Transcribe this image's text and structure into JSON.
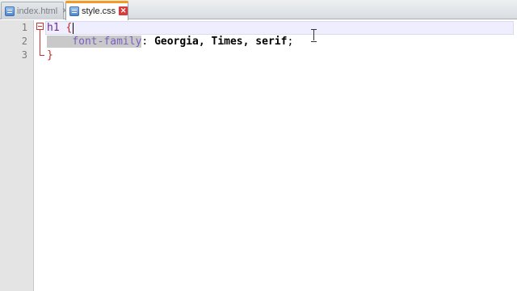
{
  "tabs": [
    {
      "label": "index.html",
      "active": false,
      "icon": "html-file-icon"
    },
    {
      "label": "style.css",
      "active": true,
      "icon": "css-file-icon"
    }
  ],
  "editor": {
    "line_numbers": [
      "1",
      "2",
      "3"
    ],
    "lines": [
      {
        "selector": "h1",
        "open_brace": "{"
      },
      {
        "property": "font-family",
        "colon": ":",
        "value": "Georgia, Times, serif",
        "semicolon": ";"
      },
      {
        "close_brace": "}"
      }
    ]
  },
  "colors": {
    "active_tab_accent": "#f59b24",
    "close_active": "#d83b3b",
    "brace": "#c22a2a",
    "selector": "#6e2a9a",
    "property": "#7b5fc0",
    "current_line": "#eeeeff",
    "selection": "#c9c9c9"
  }
}
